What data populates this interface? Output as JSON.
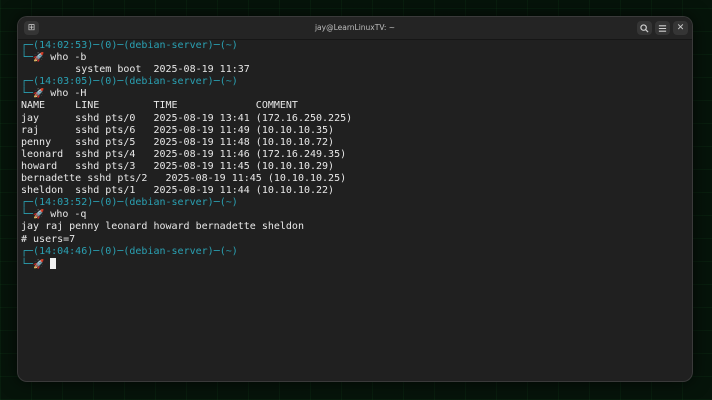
{
  "window": {
    "title": "jay@LearnLinuxTV: ~",
    "new_tab_icon": "plus-square-icon",
    "search_icon": "search-icon",
    "menu_icon": "hamburger-menu-icon",
    "close_icon": "close-icon"
  },
  "prompt": {
    "host": "debian-server",
    "dir": "~",
    "status": "0"
  },
  "blocks": [
    {
      "time": "14:02:53",
      "command": "who -b",
      "output": [
        "         system boot  2025-08-19 11:37"
      ]
    },
    {
      "time": "14:03:05",
      "command": "who -H",
      "output": [
        "NAME     LINE         TIME             COMMENT",
        "jay      sshd pts/0   2025-08-19 13:41 (172.16.250.225)",
        "raj      sshd pts/6   2025-08-19 11:49 (10.10.10.35)",
        "penny    sshd pts/5   2025-08-19 11:48 (10.10.10.72)",
        "leonard  sshd pts/4   2025-08-19 11:46 (172.16.249.35)",
        "howard   sshd pts/3   2025-08-19 11:45 (10.10.10.29)",
        "bernadette sshd pts/2   2025-08-19 11:45 (10.10.10.25)",
        "sheldon  sshd pts/1   2025-08-19 11:44 (10.10.10.22)"
      ]
    },
    {
      "time": "14:03:52",
      "command": "who -q",
      "output": [
        "jay raj penny leonard howard bernadette sheldon",
        "# users=7"
      ]
    },
    {
      "time": "14:04:46",
      "command": "",
      "output": []
    }
  ]
}
